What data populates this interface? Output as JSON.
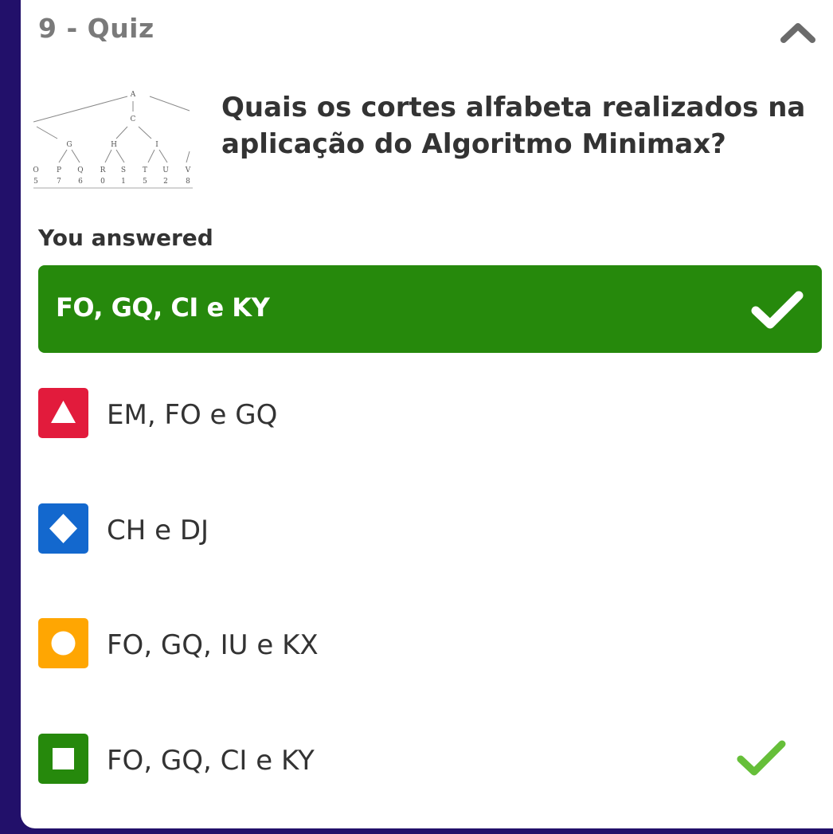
{
  "header": {
    "title": "9 - Quiz",
    "collapse_icon": "chevron-up-icon"
  },
  "question": {
    "text": "Quais os cortes alfabeta realizados na aplicação do Algoritmo Minimax?",
    "image": {
      "top_labels": [
        "A",
        "C"
      ],
      "mid_labels": [
        "G",
        "H",
        "I"
      ],
      "leaf_labels": [
        "O",
        "P",
        "Q",
        "R",
        "S",
        "T",
        "U",
        "V"
      ],
      "leaf_values": [
        "5",
        "7",
        "6",
        "0",
        "1",
        "5",
        "2",
        "8"
      ]
    }
  },
  "answered": {
    "label": "You answered",
    "value": "FO, GQ, CI e KY",
    "icon": "check-icon",
    "color": "#26890c"
  },
  "options": [
    {
      "label": "EM, FO e GQ",
      "shape": "triangle-icon",
      "color": "#e21b3c",
      "correct": false
    },
    {
      "label": "CH e DJ",
      "shape": "diamond-icon",
      "color": "#1368ce",
      "correct": false
    },
    {
      "label": "FO, GQ, IU e KX",
      "shape": "circle-icon",
      "color": "#ffa602",
      "correct": false
    },
    {
      "label": "FO, GQ, CI e KY",
      "shape": "square-icon",
      "color": "#26890c",
      "correct": true
    }
  ],
  "colors": {
    "sidebar": "#22106a",
    "correct_check": "#66bf39"
  }
}
